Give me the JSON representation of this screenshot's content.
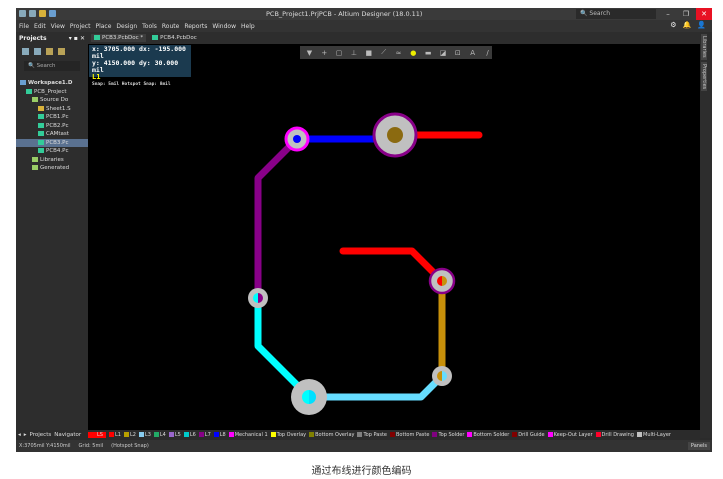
{
  "window": {
    "title": "PCB_Project1.PrjPCB - Altium Designer (18.0.11)",
    "search_placeholder": "Search",
    "minimize": "–",
    "restore": "❐",
    "close": "✕"
  },
  "menu": [
    "File",
    "Edit",
    "View",
    "Project",
    "Place",
    "Design",
    "Tools",
    "Route",
    "Reports",
    "Window",
    "Help"
  ],
  "right_tools": [
    "⚙",
    "🔔",
    "👤"
  ],
  "projects_panel": {
    "title": "Projects",
    "controls": "▾ ▪ ✕",
    "search_placeholder": "Search",
    "tree": [
      {
        "label": "Workspace1.D",
        "icon": "workspace-icon",
        "level": 0
      },
      {
        "label": "PCB_Project",
        "icon": "project-icon",
        "level": 1
      },
      {
        "label": "Source Do",
        "icon": "folder-icon",
        "level": 2
      },
      {
        "label": "Sheet1.S",
        "icon": "schematic-icon",
        "level": 3
      },
      {
        "label": "PCB1.Pc",
        "icon": "pcb-icon",
        "level": 3
      },
      {
        "label": "PCB2.Pc",
        "icon": "pcb-icon",
        "level": 3
      },
      {
        "label": "CAMtast",
        "icon": "cam-icon",
        "level": 3
      },
      {
        "label": "PCB3.Pc",
        "icon": "pcb-icon",
        "level": 3,
        "selected": true
      },
      {
        "label": "PCB4.Pc",
        "icon": "pcb-icon",
        "level": 3
      },
      {
        "label": "Libraries",
        "icon": "folder-icon",
        "level": 2
      },
      {
        "label": "Generated",
        "icon": "folder-icon",
        "level": 2
      }
    ],
    "bottom_tabs": [
      "Projects",
      "Navigator"
    ]
  },
  "doc_tabs": [
    {
      "label": "PCB3.PcbDoc *",
      "active": true
    },
    {
      "label": "PCB4.PcbDoc",
      "active": false
    }
  ],
  "coords": {
    "x": "x:  3705.000",
    "dx": "dx:  -195.000 mil",
    "y": "y:  4150.000",
    "dy": "dy:     30.000 mil",
    "layer": "L1",
    "snap": "Snap: 5mil Hotspot Snap: 8mil"
  },
  "toolbar": [
    {
      "icon": "filter-icon",
      "glyph": "▼"
    },
    {
      "icon": "crosshair-icon",
      "glyph": "+"
    },
    {
      "icon": "select-rect-icon",
      "glyph": "▢"
    },
    {
      "icon": "align-icon",
      "glyph": "⊥"
    },
    {
      "icon": "component-icon",
      "glyph": "■"
    },
    {
      "icon": "route-icon",
      "glyph": "⟋"
    },
    {
      "icon": "diff-pair-icon",
      "glyph": "≈"
    },
    {
      "icon": "via-icon",
      "glyph": "●"
    },
    {
      "icon": "fill-icon",
      "glyph": "▬"
    },
    {
      "icon": "region-icon",
      "glyph": "◪"
    },
    {
      "icon": "dimension-icon",
      "glyph": "⊡"
    },
    {
      "icon": "text-icon",
      "glyph": "A"
    },
    {
      "icon": "line-icon",
      "glyph": "/"
    }
  ],
  "right_panels": [
    "Libraries",
    "Properties"
  ],
  "layers": [
    {
      "name": "LS",
      "color": "#ff0000"
    },
    {
      "name": "L1",
      "color": "#ff0000"
    },
    {
      "name": "L2",
      "color": "#b8a000"
    },
    {
      "name": "L3",
      "color": "#88ccee"
    },
    {
      "name": "L4",
      "color": "#22aa66"
    },
    {
      "name": "L5",
      "color": "#9966cc"
    },
    {
      "name": "L6",
      "color": "#00cccc"
    },
    {
      "name": "L7",
      "color": "#880088"
    },
    {
      "name": "L8",
      "color": "#0000ff"
    },
    {
      "name": "Mechanical 1",
      "color": "#ff00ff"
    },
    {
      "name": "Top Overlay",
      "color": "#ffff00"
    },
    {
      "name": "Bottom Overlay",
      "color": "#808000"
    },
    {
      "name": "Top Paste",
      "color": "#808080"
    },
    {
      "name": "Bottom Paste",
      "color": "#800000"
    },
    {
      "name": "Top Solder",
      "color": "#800080"
    },
    {
      "name": "Bottom Solder",
      "color": "#ff00ff"
    },
    {
      "name": "Drill Guide",
      "color": "#800000"
    },
    {
      "name": "Keep-Out Layer",
      "color": "#ff00ff"
    },
    {
      "name": "Drill Drawing",
      "color": "#ff002a"
    },
    {
      "name": "Multi-Layer",
      "color": "#c0c0c0"
    }
  ],
  "status": {
    "position": "X:3705mil Y:4150mil",
    "grid": "Grid: 5mil",
    "snap": "(Hotspot Snap)",
    "panels": "Panels"
  },
  "caption": "通过布线进行颜色编码"
}
